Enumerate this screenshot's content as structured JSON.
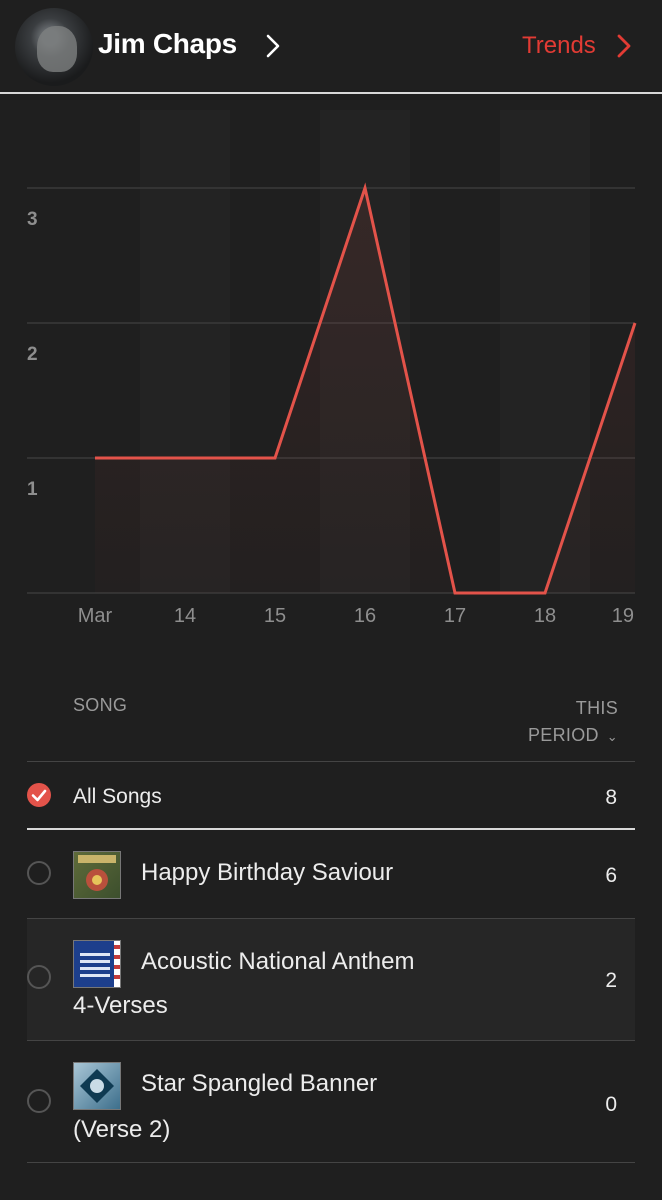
{
  "header": {
    "artist_name": "Jim Chaps",
    "trends_label": "Trends",
    "accent": "#e23b34"
  },
  "chart_data": {
    "type": "line",
    "categories": [
      "Mar",
      "14",
      "15",
      "16",
      "17",
      "18",
      "19"
    ],
    "values": [
      1,
      1,
      1,
      3,
      0,
      0,
      2
    ],
    "y_ticks": [
      "1",
      "2",
      "3"
    ],
    "ylim": [
      0,
      3
    ],
    "grid": true,
    "line_color": "#e3534a"
  },
  "table": {
    "col_song": "SONG",
    "col_period_1": "THIS",
    "col_period_2": "PERIOD",
    "all_songs": {
      "title": "All Songs",
      "count": "8"
    },
    "songs": [
      {
        "title_line1": "Happy Birthday Saviour",
        "title_line2": "",
        "count": "6"
      },
      {
        "title_line1": "Acoustic National Anthem",
        "title_line2": "4-Verses",
        "count": "2"
      },
      {
        "title_line1": "Star Spangled Banner",
        "title_line2": "(Verse 2)",
        "count": "0"
      }
    ]
  }
}
